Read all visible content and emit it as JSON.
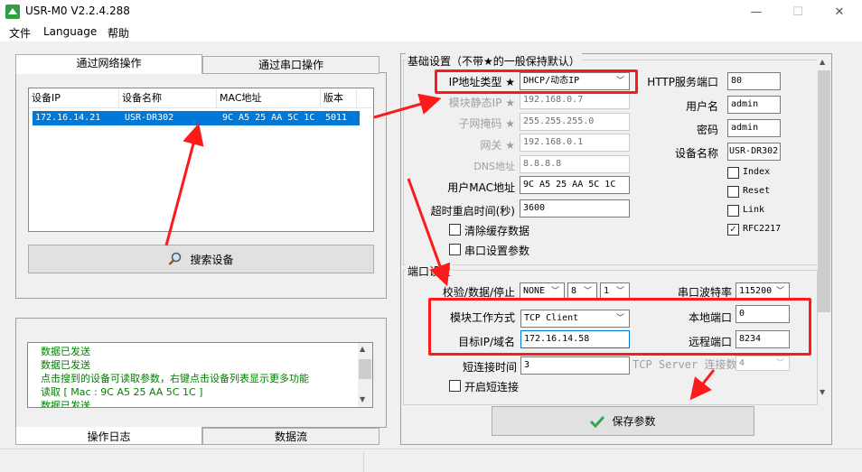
{
  "window": {
    "title": "USR-M0 V2.2.4.288",
    "min_glyph": "—",
    "max_glyph": "☐",
    "close_glyph": "✕"
  },
  "menu": [
    "文件",
    "Language",
    "帮助"
  ],
  "left": {
    "tabs_top": [
      "通过网络操作",
      "通过串口操作"
    ],
    "device_list": {
      "columns": [
        "设备IP",
        "设备名称",
        "MAC地址",
        "版本"
      ],
      "rows": [
        {
          "ip": "172.16.14.21",
          "name": "USR-DR302",
          "mac": "9C A5 25 AA 5C 1C",
          "version": "5011"
        }
      ]
    },
    "search_button": "搜索设备",
    "log_lines": [
      "数据已发送",
      "数据已发送",
      "点击搜到的设备可读取参数，右键点击设备列表显示更多功能",
      "读取 [ Mac : 9C A5 25 AA 5C 1C ]",
      "数据已发送"
    ],
    "tabs_bottom": [
      "操作日志",
      "数据流"
    ]
  },
  "basic": {
    "group_title": "基础设置（不带★的一般保持默认）",
    "ip_type_label": "IP地址类型 ★",
    "ip_type_value": "DHCP/动态IP",
    "static_ip_label": "模块静态IP ★",
    "static_ip_value": "192.168.0.7",
    "mask_label": "子网掩码 ★",
    "mask_value": "255.255.255.0",
    "gateway_label": "网关 ★",
    "gateway_value": "192.168.0.1",
    "dns_label": "DNS地址",
    "dns_value": "8.8.8.8",
    "mac_label": "用户MAC地址",
    "mac_value": "9C A5 25 AA 5C 1C",
    "timeout_label": "超时重启时间(秒)",
    "timeout_value": "3600",
    "clear_cache_label": "清除缓存数据",
    "serial_params_label": "串口设置参数",
    "http_port_label": "HTTP服务端口",
    "http_port_value": "80",
    "username_label": "用户名",
    "username_value": "admin",
    "password_label": "密码",
    "password_value": "admin",
    "device_name_label": "设备名称",
    "device_name_value": "USR-DR302",
    "options": [
      {
        "label": "Index",
        "checked": false
      },
      {
        "label": "Reset",
        "checked": false
      },
      {
        "label": "Link",
        "checked": false
      },
      {
        "label": "RFC2217",
        "checked": true
      }
    ]
  },
  "port": {
    "group_title": "端口设置",
    "parity_label": "校验/数据/停止",
    "parity_value": "NONE",
    "data_bits_value": "8",
    "stop_bits_value": "1",
    "baud_label": "串口波特率",
    "baud_value": "115200",
    "work_mode_label": "模块工作方式",
    "work_mode_value": "TCP Client",
    "local_port_label": "本地端口",
    "local_port_value": "0",
    "target_label": "目标IP/域名",
    "target_value": "172.16.14.58",
    "remote_port_label": "远程端口",
    "remote_port_value": "8234",
    "short_conn_time_label": "短连接时间",
    "short_conn_time_value": "3",
    "tcp_server_label": "TCP Server 连接数",
    "tcp_server_value": "4",
    "short_conn_label": "开启短连接"
  },
  "save_button": "保存参数",
  "colors": {
    "accent": "#0078d7",
    "annotation": "#ff1a1a",
    "log_text": "#008000"
  }
}
